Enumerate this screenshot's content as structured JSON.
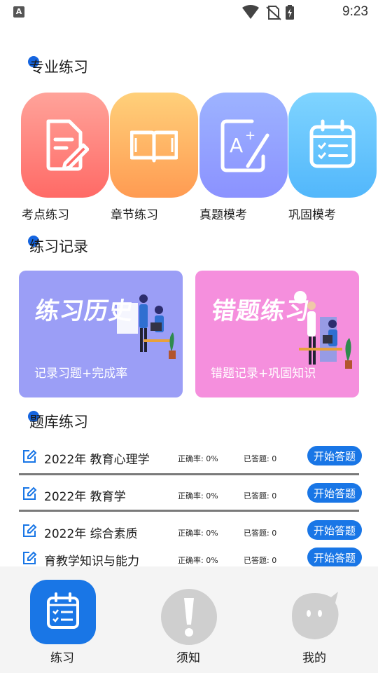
{
  "status_bar": {
    "time": "9:23",
    "notice_letter": "A"
  },
  "sections": {
    "professional": "专业练习",
    "records": "练习记录",
    "bank": "题库练习"
  },
  "tiles": [
    {
      "label": "考点练习",
      "icon": "document-pen-icon",
      "gradient": [
        "#ffa39a",
        "#ff6a66"
      ]
    },
    {
      "label": "章节练习",
      "icon": "open-book-icon",
      "gradient": [
        "#ffd07a",
        "#ff9b52"
      ]
    },
    {
      "label": "真题模考",
      "icon": "exam-a-plus-icon",
      "gradient": [
        "#9db3ff",
        "#8b92ff"
      ]
    },
    {
      "label": "巩固模考",
      "icon": "calendar-checklist-icon",
      "gradient": [
        "#7fd4ff",
        "#52b7fb"
      ]
    }
  ],
  "banners": [
    {
      "title": "练习历史",
      "subtitle": "记录习题+完成率",
      "color": "#9b9ef6"
    },
    {
      "title": "错题练习",
      "subtitle": "错题记录+巩固知识",
      "color": "#f58fdd"
    }
  ],
  "question_bank": [
    {
      "name": "2022年 教育心理学",
      "rate": "正确率: 0%",
      "done": "已答题: 0",
      "button": "开始答题"
    },
    {
      "name": "2022年 教育学",
      "rate": "正确率: 0%",
      "done": "已答题: 0",
      "button": "开始答题"
    },
    {
      "name": "2022年 综合素质",
      "rate": "正确率: 0%",
      "done": "已答题: 0",
      "button": "开始答题"
    },
    {
      "name": "育教学知识与能力",
      "rate": "正确率: 0%",
      "done": "已答题: 0",
      "button": "开始答题"
    }
  ],
  "bottom_nav": [
    {
      "label": "练习",
      "icon": "calendar-checklist-icon",
      "active": true
    },
    {
      "label": "须知",
      "icon": "exclamation-icon",
      "active": false
    },
    {
      "label": "我的",
      "icon": "chat-face-icon",
      "active": false
    }
  ],
  "colors": {
    "accent": "#1976e6",
    "dot": "#1565e0",
    "nav_bg": "#f4f4f4"
  }
}
